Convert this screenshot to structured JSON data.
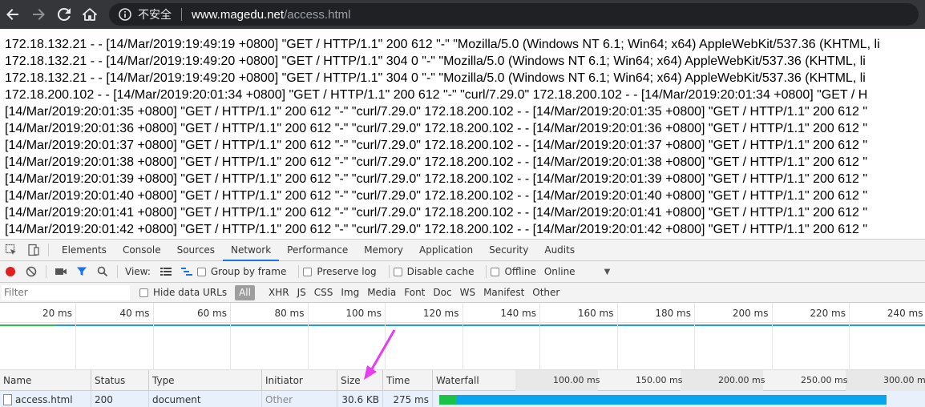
{
  "browser": {
    "security_label": "不安全",
    "url_host": "www.magedu.net",
    "url_path": "/access.html"
  },
  "page": {
    "log_lines": [
      "172.18.132.21 - - [14/Mar/2019:19:49:19 +0800] \"GET / HTTP/1.1\" 200 612 \"-\" \"Mozilla/5.0 (Windows NT 6.1; Win64; x64) AppleWebKit/537.36 (KHTML, li",
      "172.18.132.21 - - [14/Mar/2019:19:49:20 +0800] \"GET / HTTP/1.1\" 304 0 \"-\" \"Mozilla/5.0 (Windows NT 6.1; Win64; x64) AppleWebKit/537.36 (KHTML, li",
      "172.18.132.21 - - [14/Mar/2019:19:49:20 +0800] \"GET / HTTP/1.1\" 304 0 \"-\" \"Mozilla/5.0 (Windows NT 6.1; Win64; x64) AppleWebKit/537.36 (KHTML, li",
      "172.18.200.102 - - [14/Mar/2019:20:01:34 +0800] \"GET / HTTP/1.1\" 200 612 \"-\" \"curl/7.29.0\" 172.18.200.102 - - [14/Mar/2019:20:01:34 +0800] \"GET / H",
      "[14/Mar/2019:20:01:35 +0800] \"GET / HTTP/1.1\" 200 612 \"-\" \"curl/7.29.0\" 172.18.200.102 - - [14/Mar/2019:20:01:35 +0800] \"GET / HTTP/1.1\" 200 612 \"",
      "[14/Mar/2019:20:01:36 +0800] \"GET / HTTP/1.1\" 200 612 \"-\" \"curl/7.29.0\" 172.18.200.102 - - [14/Mar/2019:20:01:36 +0800] \"GET / HTTP/1.1\" 200 612 \"",
      "[14/Mar/2019:20:01:37 +0800] \"GET / HTTP/1.1\" 200 612 \"-\" \"curl/7.29.0\" 172.18.200.102 - - [14/Mar/2019:20:01:37 +0800] \"GET / HTTP/1.1\" 200 612 \"",
      "[14/Mar/2019:20:01:38 +0800] \"GET / HTTP/1.1\" 200 612 \"-\" \"curl/7.29.0\" 172.18.200.102 - - [14/Mar/2019:20:01:38 +0800] \"GET / HTTP/1.1\" 200 612 \"",
      "[14/Mar/2019:20:01:39 +0800] \"GET / HTTP/1.1\" 200 612 \"-\" \"curl/7.29.0\" 172.18.200.102 - - [14/Mar/2019:20:01:39 +0800] \"GET / HTTP/1.1\" 200 612 \"",
      "[14/Mar/2019:20:01:40 +0800] \"GET / HTTP/1.1\" 200 612 \"-\" \"curl/7.29.0\" 172.18.200.102 - - [14/Mar/2019:20:01:40 +0800] \"GET / HTTP/1.1\" 200 612 \"",
      "[14/Mar/2019:20:01:41 +0800] \"GET / HTTP/1.1\" 200 612 \"-\" \"curl/7.29.0\" 172.18.200.102 - - [14/Mar/2019:20:01:41 +0800] \"GET / HTTP/1.1\" 200 612 \"",
      "[14/Mar/2019:20:01:42 +0800] \"GET / HTTP/1.1\" 200 612 \"-\" \"curl/7.29.0\" 172.18.200.102 - - [14/Mar/2019:20:01:42 +0800] \"GET / HTTP/1.1\" 200 612 \""
    ]
  },
  "devtools": {
    "tabs": [
      "Elements",
      "Console",
      "Sources",
      "Network",
      "Performance",
      "Memory",
      "Application",
      "Security",
      "Audits"
    ],
    "active_tab": "Network",
    "toolbar": {
      "view_label": "View:",
      "group_by_frame": "Group by frame",
      "preserve_log": "Preserve log",
      "disable_cache": "Disable cache",
      "offline": "Offline",
      "throttling": "Online"
    },
    "filter": {
      "placeholder": "Filter",
      "hide_data_urls": "Hide data URLs",
      "types": [
        "All",
        "XHR",
        "JS",
        "CSS",
        "Img",
        "Media",
        "Font",
        "Doc",
        "WS",
        "Manifest",
        "Other"
      ]
    },
    "overview_ticks": [
      "20 ms",
      "40 ms",
      "60 ms",
      "80 ms",
      "100 ms",
      "120 ms",
      "140 ms",
      "160 ms",
      "180 ms",
      "200 ms",
      "220 ms",
      "240 ms"
    ],
    "columns": [
      "Name",
      "Status",
      "Type",
      "Initiator",
      "Size",
      "Time",
      "Waterfall"
    ],
    "waterfall_ticks": [
      "100.00 ms",
      "150.00 ms",
      "200.00 ms",
      "250.00 ms",
      "300.00 ms"
    ],
    "requests": [
      {
        "name": "access.html",
        "status": "200",
        "type": "document",
        "initiator": "Other",
        "size": "30.6 KB",
        "time": "275 ms",
        "waiting_ms": 13,
        "download_ms": 275
      }
    ]
  },
  "colors": {
    "annotation_arrow": "#e83cf0",
    "waterfall_waiting": "#1bc24a",
    "waterfall_download": "#07a6ee"
  }
}
